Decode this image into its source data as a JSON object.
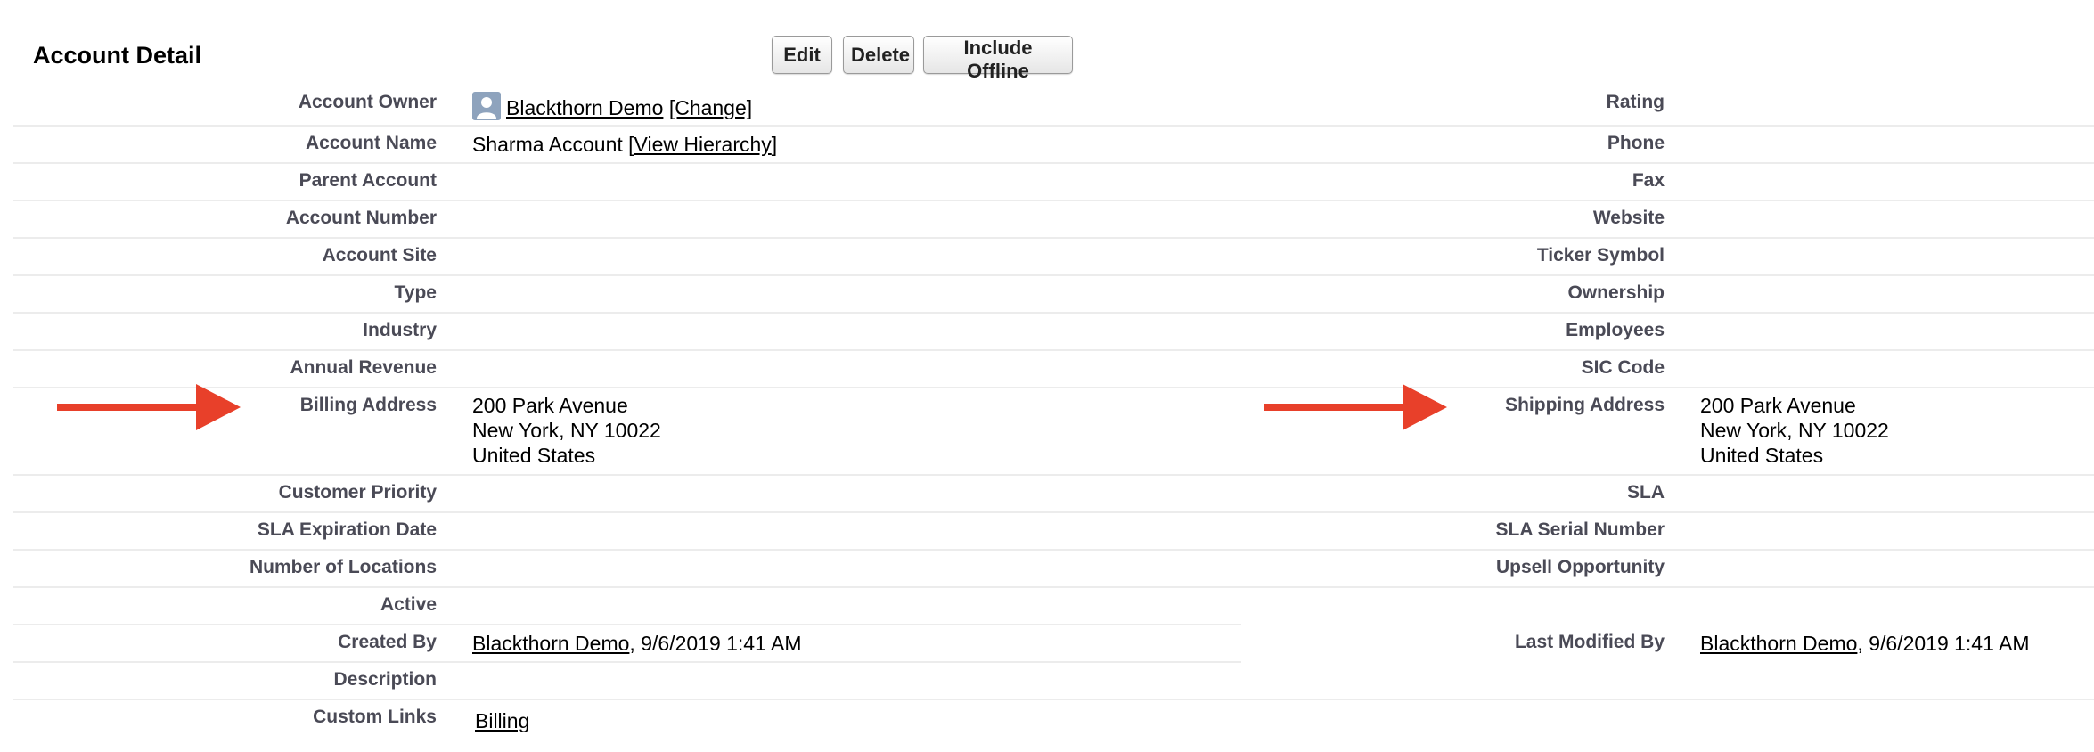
{
  "section_title": "Account Detail",
  "buttons": {
    "edit": "Edit",
    "delete": "Delete",
    "include_offline": "Include Offline"
  },
  "left_labels": {
    "account_owner": "Account Owner",
    "account_name": "Account Name",
    "parent_account": "Parent Account",
    "account_number": "Account Number",
    "account_site": "Account Site",
    "type": "Type",
    "industry": "Industry",
    "annual_revenue": "Annual Revenue",
    "billing_address": "Billing Address",
    "customer_priority": "Customer Priority",
    "sla_expiration_date": "SLA Expiration Date",
    "number_of_locations": "Number of Locations",
    "active": "Active",
    "created_by": "Created By",
    "description": "Description",
    "custom_links": "Custom Links"
  },
  "right_labels": {
    "rating": "Rating",
    "phone": "Phone",
    "fax": "Fax",
    "website": "Website",
    "ticker_symbol": "Ticker Symbol",
    "ownership": "Ownership",
    "employees": "Employees",
    "sic_code": "SIC Code",
    "shipping_address": "Shipping Address",
    "sla": "SLA",
    "sla_serial_number": "SLA Serial Number",
    "upsell_opportunity": "Upsell Opportunity",
    "last_modified_by": "Last Modified By"
  },
  "values": {
    "owner_name": "Blackthorn Demo",
    "owner_change": "[Change]",
    "account_name": "Sharma Account",
    "view_hierarchy_open": "[",
    "view_hierarchy": "View Hierarchy",
    "view_hierarchy_close": "]",
    "billing_address": {
      "line1": "200 Park Avenue",
      "line2": "New York, NY 10022",
      "line3": "United States"
    },
    "shipping_address": {
      "line1": "200 Park Avenue",
      "line2": "New York, NY 10022",
      "line3": "United States"
    },
    "created_by_name": "Blackthorn Demo",
    "created_by_date": ", 9/6/2019 1:41 AM",
    "last_modified_by_name": "Blackthorn Demo",
    "last_modified_by_date": ", 9/6/2019 1:41 AM",
    "custom_link": "Billing"
  },
  "colors": {
    "arrow": "#e8402a",
    "label": "#4a4a56",
    "divider": "#ececec"
  },
  "icons": {
    "owner_avatar": "user-avatar-icon",
    "arrow": "arrow-right-icon"
  }
}
